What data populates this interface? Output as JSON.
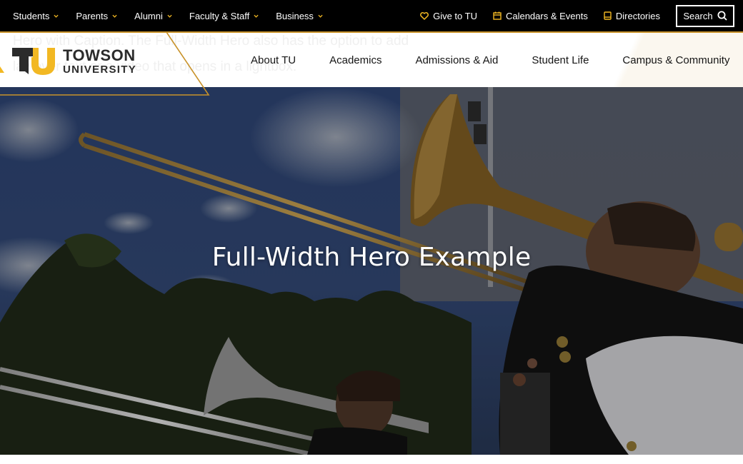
{
  "utility_bar": {
    "audiences": [
      {
        "label": "Students",
        "icon": "chevron-down-icon"
      },
      {
        "label": "Parents",
        "icon": "chevron-down-icon"
      },
      {
        "label": "Alumni",
        "icon": "chevron-down-icon"
      },
      {
        "label": "Faculty & Staff",
        "icon": "chevron-down-icon"
      },
      {
        "label": "Business",
        "icon": "chevron-down-icon"
      }
    ],
    "links": [
      {
        "label": "Give to TU",
        "icon": "heart-icon"
      },
      {
        "label": "Calendars & Events",
        "icon": "calendar-icon"
      },
      {
        "label": "Directories",
        "icon": "book-icon"
      }
    ],
    "search_label": "Search",
    "accent_color": "#f2b823"
  },
  "header": {
    "logo": {
      "line1": "TOWSON",
      "line2": "UNIVERSITY",
      "mark": "TU"
    },
    "ghost_text_line1": "Hero with Caption. The Full-Width Hero also has the option to add",
    "ghost_text_line2": "lay over text or a video that opens in a lightbox.",
    "nav": [
      {
        "label": "About TU"
      },
      {
        "label": "Academics"
      },
      {
        "label": "Admissions & Aid"
      },
      {
        "label": "Student Life"
      },
      {
        "label": "Campus & Community"
      }
    ]
  },
  "hero": {
    "title": "Full-Width Hero Example",
    "image_description": "trombone-players-marching-band"
  },
  "colors": {
    "gold": "#f2b823",
    "gold_line": "#c8922a",
    "black": "#000000",
    "charcoal": "#2b2b2b"
  }
}
